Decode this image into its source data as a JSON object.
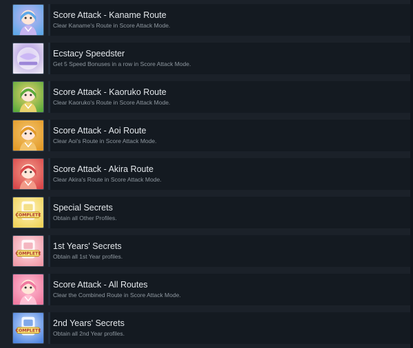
{
  "achievements": [
    {
      "title": "Score Attack - Kaname Route",
      "description": "Clear Kaname's Route in Score Attack Mode.",
      "icon": "kaname-portrait-icon",
      "colors": [
        "#5fa8e8",
        "#c7b5f0"
      ]
    },
    {
      "title": "Ecstacy Speedster",
      "description": "Get 5 Speed Bonuses in a row in Score Attack Mode.",
      "icon": "ecstasy-shot-logo-icon",
      "colors": [
        "#e9e4f2",
        "#a78be0"
      ]
    },
    {
      "title": "Score Attack - Kaoruko Route",
      "description": "Clear Kaoruko's Route in Score Attack Mode.",
      "icon": "kaoruko-portrait-icon",
      "colors": [
        "#5cab3c",
        "#e8d26c"
      ]
    },
    {
      "title": "Score Attack - Aoi Route",
      "description": "Clear Aoi's Route in Score Attack Mode.",
      "icon": "aoi-portrait-icon",
      "colors": [
        "#e39a28",
        "#f3c36a"
      ]
    },
    {
      "title": "Score Attack - Akira Route",
      "description": "Clear Akira's Route in Score Attack Mode.",
      "icon": "akira-portrait-icon",
      "colors": [
        "#d9474a",
        "#f29a88"
      ]
    },
    {
      "title": "Special Secrets",
      "description": "Obtain all Other Profiles.",
      "icon": "complete-badge-icon",
      "colors": [
        "#f0d35a",
        "#fff1b8"
      ]
    },
    {
      "title": "1st Years' Secrets",
      "description": "Obtain all 1st Year profiles.",
      "icon": "complete-badge-icon",
      "colors": [
        "#f09aa8",
        "#ffe0e6"
      ]
    },
    {
      "title": "Score Attack - All Routes",
      "description": "Clear the Combined Route in Score Attack Mode.",
      "icon": "pink-hair-portrait-icon",
      "colors": [
        "#f07aa0",
        "#ffc0d4"
      ]
    },
    {
      "title": "2nd Years' Secrets",
      "description": "Obtain all 2nd Year profiles.",
      "icon": "complete-badge-icon",
      "colors": [
        "#4f86e0",
        "#cfe0ff"
      ]
    }
  ]
}
